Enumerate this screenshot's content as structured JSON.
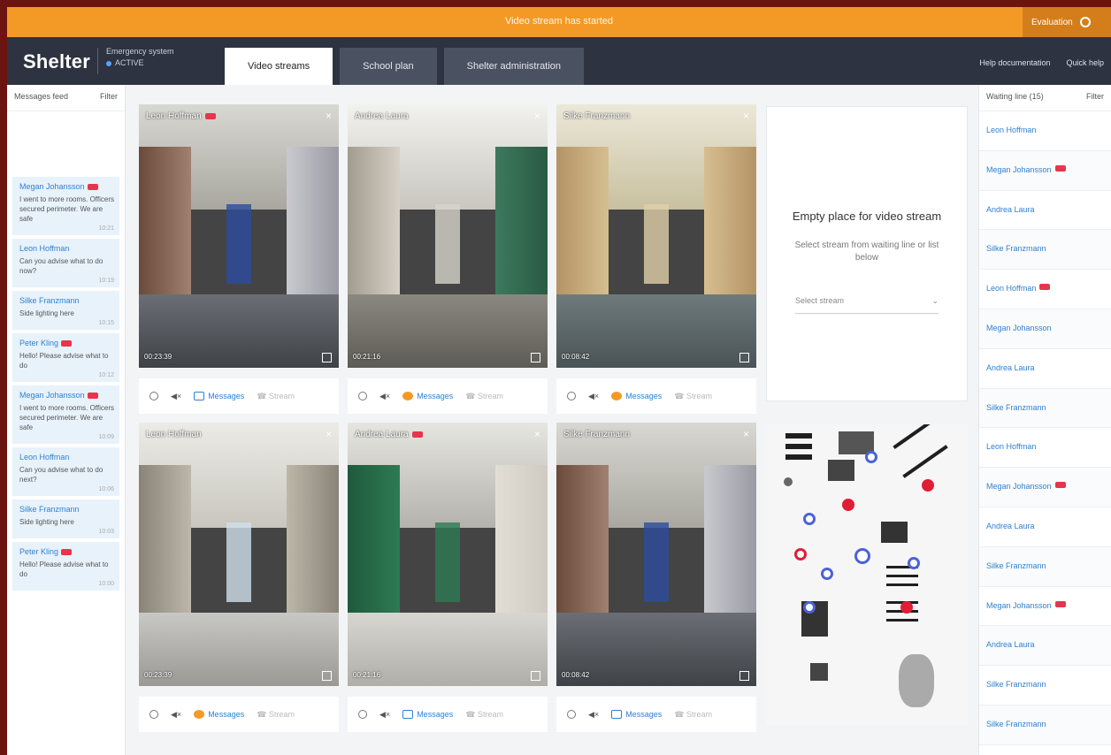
{
  "banner": {
    "text": "Video stream has started",
    "right_label": "Evaluation"
  },
  "header": {
    "logo": "Shelter",
    "status_line1": "Emergency system",
    "status_line2": "ACTIVE",
    "tabs": [
      {
        "label": "Video streams",
        "active": true
      },
      {
        "label": "School plan",
        "active": false
      },
      {
        "label": "Shelter administration",
        "active": false
      }
    ],
    "right_links": [
      "Help documentation",
      "Quick help"
    ]
  },
  "left_panel": {
    "title": "Messages feed",
    "filter": "Filter",
    "messages": [
      {
        "name": "Megan Johansson",
        "badge": true,
        "text": "I went to more rooms. Officers secured perimeter. We are safe",
        "time": "10:21"
      },
      {
        "name": "Leon Hoffman",
        "badge": false,
        "text": "Can you advise what to do now?",
        "time": "10:19"
      },
      {
        "name": "Silke Franzmann",
        "badge": false,
        "text": "Side lighting here",
        "time": "10:15"
      },
      {
        "name": "Peter Kling",
        "badge": true,
        "text": "Hello! Please advise what to do",
        "time": "10:12"
      },
      {
        "name": "Megan Johansson",
        "badge": true,
        "text": "I went to more rooms. Officers secured perimeter. We are safe",
        "time": "10:09"
      },
      {
        "name": "Leon Hoffman",
        "badge": false,
        "text": "Can you advise what to do next?",
        "time": "10:06"
      },
      {
        "name": "Silke Franzmann",
        "badge": false,
        "text": "Side lighting here",
        "time": "10:03"
      },
      {
        "name": "Peter Kling",
        "badge": true,
        "text": "Hello! Please advise what to do",
        "time": "10:00"
      }
    ]
  },
  "streams": [
    {
      "name": "Leon Hoffman",
      "badge": true,
      "time": "00:23:39",
      "msg_highlight": false,
      "scene": "lobby"
    },
    {
      "name": "Andrea Laura",
      "badge": false,
      "time": "00:21:16",
      "msg_highlight": true,
      "scene": "hallway"
    },
    {
      "name": "Silke Franzmann",
      "badge": false,
      "time": "00:08:42",
      "msg_highlight": true,
      "scene": "library"
    },
    {
      "name": "Leon Hoffman",
      "badge": false,
      "time": "00:23:39",
      "msg_highlight": true,
      "scene": "corridor"
    },
    {
      "name": "Andrea Laura",
      "badge": true,
      "time": "00:21:16",
      "msg_highlight": false,
      "scene": "lockers"
    },
    {
      "name": "Silke Franzmann",
      "badge": false,
      "time": "00:08:42",
      "msg_highlight": false,
      "scene": "lobby"
    }
  ],
  "controls": {
    "messages": "Messages",
    "stream": "Stream"
  },
  "empty_slot": {
    "title": "Empty place for video stream",
    "subtitle": "Select stream from waiting line or list below",
    "select_placeholder": "Select stream"
  },
  "right_panel": {
    "title": "Waiting line (15)",
    "filter": "Filter",
    "items": [
      {
        "name": "Leon Hoffman",
        "badge": false
      },
      {
        "name": "Megan Johansson",
        "badge": true
      },
      {
        "name": "Andrea Laura",
        "badge": false
      },
      {
        "name": "Silke Franzmann",
        "badge": false
      },
      {
        "name": "Leon Hoffman",
        "badge": true
      },
      {
        "name": "Megan Johansson",
        "badge": false
      },
      {
        "name": "Andrea Laura",
        "badge": false
      },
      {
        "name": "Silke Franzmann",
        "badge": false
      },
      {
        "name": "Leon Hoffman",
        "badge": false
      },
      {
        "name": "Megan Johansson",
        "badge": true
      },
      {
        "name": "Andrea Laura",
        "badge": false
      },
      {
        "name": "Silke Franzmann",
        "badge": false
      },
      {
        "name": "Megan Johansson",
        "badge": true
      },
      {
        "name": "Andrea Laura",
        "badge": false
      },
      {
        "name": "Silke Franzmann",
        "badge": false
      },
      {
        "name": "Silke Franzmann",
        "badge": false
      }
    ]
  },
  "colors": {
    "banner": "#f39a26",
    "header": "#2d3340",
    "link": "#2f80d1",
    "badge": "#e8344c",
    "map_red": "#e11d35",
    "map_blue": "#4a63d6"
  }
}
